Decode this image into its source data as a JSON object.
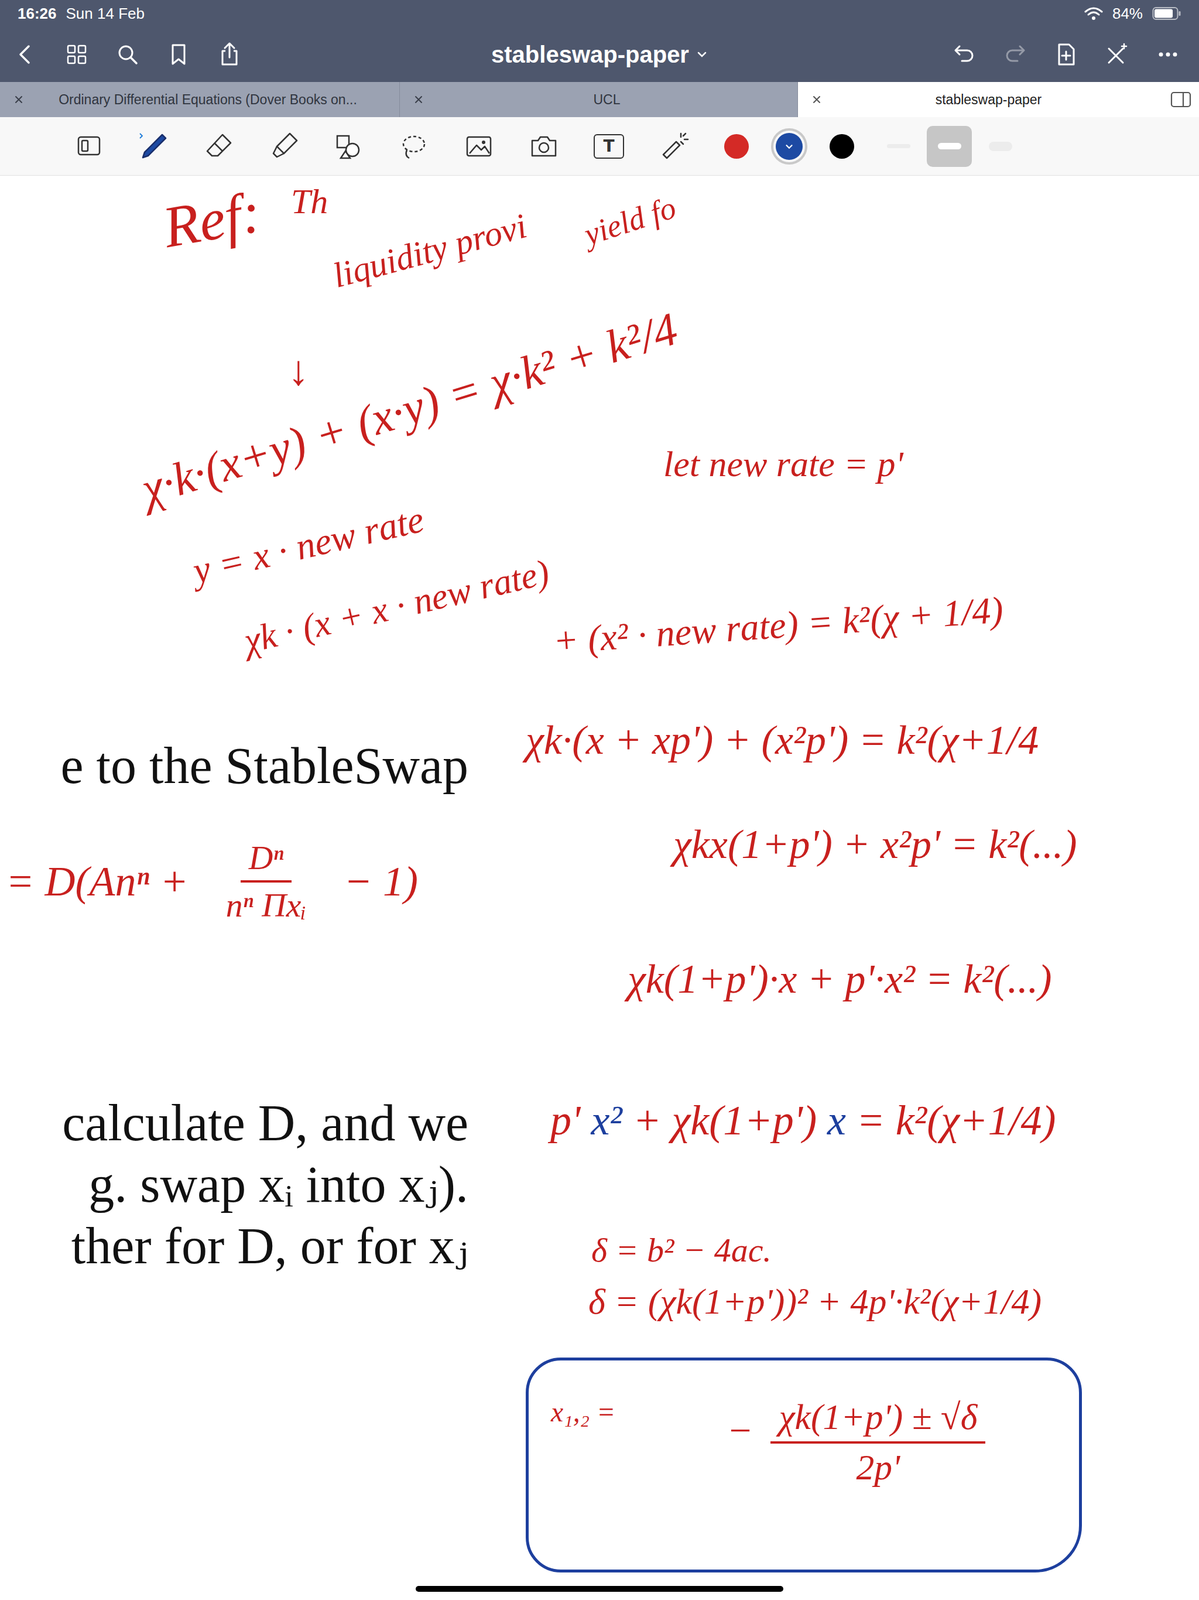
{
  "status_bar": {
    "time": "16:26",
    "date": "Sun 14 Feb",
    "battery": "84%",
    "battery_level": 0.84
  },
  "toolbar": {
    "title": "stableswap-paper",
    "redo_enabled": false
  },
  "tabs": [
    {
      "label": "Ordinary Differential Equations (Dover Books on...",
      "selected": false
    },
    {
      "label": "UCL",
      "selected": false
    },
    {
      "label": "stableswap-paper",
      "selected": true
    }
  ],
  "tools": [
    {
      "kind": "page",
      "selected": false
    },
    {
      "kind": "pen",
      "selected": true
    },
    {
      "kind": "eraser",
      "selected": false
    },
    {
      "kind": "highlighter",
      "selected": false
    },
    {
      "kind": "shapes",
      "selected": false
    },
    {
      "kind": "lasso",
      "selected": false
    },
    {
      "kind": "image",
      "selected": false
    },
    {
      "kind": "camera",
      "selected": false
    },
    {
      "kind": "text",
      "glyph": "T",
      "selected": false
    },
    {
      "kind": "laser",
      "selected": false
    }
  ],
  "pen_colors": [
    {
      "color": "#d42a26",
      "selected": false
    },
    {
      "color": "#1d4aa3",
      "selected": true
    },
    {
      "color": "#000000",
      "selected": false
    }
  ],
  "pen_widths": [
    {
      "level": 0.3,
      "selected": false
    },
    {
      "level": 0.6,
      "selected": true
    },
    {
      "level": 1,
      "selected": false
    }
  ],
  "document": {
    "paragraphs": [
      [
        "e to the StableSwap"
      ],
      [
        "calculate D, and we",
        "g. swap xᵢ into xⱼ).",
        "ther for D, or for xⱼ"
      ]
    ]
  },
  "notes": [
    {
      "kind": "line",
      "text": "Ref:",
      "color": "#c8201e"
    },
    {
      "kind": "line",
      "text": "Th",
      "color": "#c8201e"
    },
    {
      "kind": "line",
      "text": "liquidity provi",
      "color": "#c8201e"
    },
    {
      "kind": "line",
      "text": "yield fo",
      "color": "#c8201e"
    },
    {
      "kind": "line",
      "text": "χ·k·(x+y) + (x·y) = χ·k² + k²/4",
      "color": "#c8201e"
    },
    {
      "kind": "line",
      "text": "↓",
      "color": "#c8201e"
    },
    {
      "kind": "line",
      "text": "let new rate = p'",
      "color": "#c8201e"
    },
    {
      "kind": "line",
      "text": "y = x · new rate",
      "color": "#c8201e"
    },
    {
      "kind": "line",
      "text": "χk · (x + x · new rate)",
      "color": "#c8201e"
    },
    {
      "kind": "line",
      "text": "+ (x² · new rate) = k²(χ + 1/4)",
      "color": "#c8201e"
    },
    {
      "kind": "line",
      "text": "χk·(x + xp') + (x²p') = k²(χ+1/4",
      "color": "#c8201e"
    },
    {
      "kind": "fraction",
      "before": "= D(Anⁿ +",
      "numerator": "Dⁿ",
      "denominator": "nⁿ Πxᵢ",
      "after": "− 1)",
      "color": "#c8201e"
    },
    {
      "kind": "line",
      "text": "χkx(1+p') + x²p' = k²(...)",
      "color": "#c8201e"
    },
    {
      "kind": "line",
      "text": "χk(1+p')·x + p'·x² = k²(...)",
      "color": "#c8201e"
    },
    {
      "kind": "mixed",
      "segments": [
        {
          "text": "p' ",
          "color": "#c8201e"
        },
        {
          "text": "x²",
          "color": "#1d3f9e"
        },
        {
          "text": " + χk(1+p') ",
          "color": "#c8201e"
        },
        {
          "text": "x",
          "color": "#1d3f9e"
        },
        {
          "text": " = k²(χ+1/4)",
          "color": "#c8201e"
        }
      ]
    },
    {
      "kind": "line",
      "text": "δ = b² − 4ac.",
      "color": "#c8201e"
    },
    {
      "kind": "line",
      "text": "δ = (χk(1+p'))² + 4p'·k²(χ+1/4)",
      "color": "#c8201e"
    },
    {
      "kind": "boxed",
      "lhs": "x₁,₂ =",
      "sign": "−",
      "numerator": "χk(1+p') ± √δ",
      "denominator": "2p'",
      "color": "#c8201e",
      "box_color": "#1d3f9e"
    }
  ]
}
